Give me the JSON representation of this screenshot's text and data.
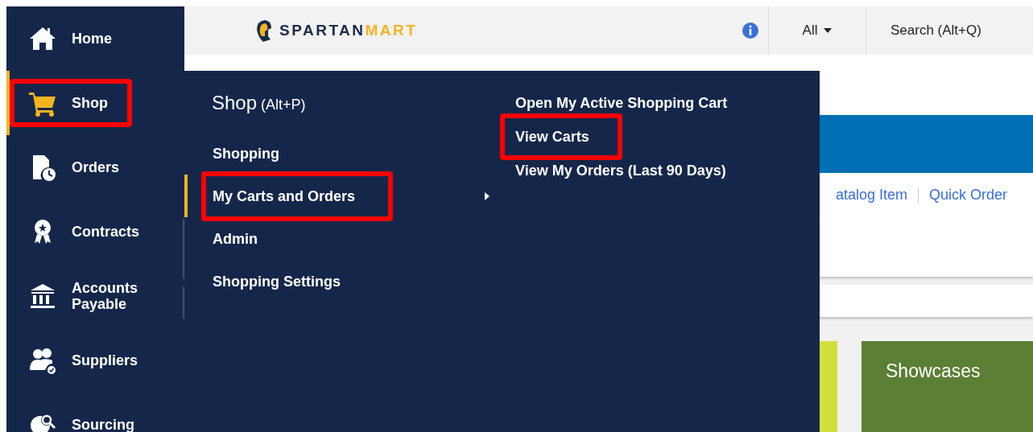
{
  "sidebar": {
    "items": [
      {
        "label": "Home",
        "selected": false
      },
      {
        "label": "Shop",
        "selected": true,
        "highlighted": true
      },
      {
        "label": "Orders",
        "selected": false
      },
      {
        "label": "Contracts",
        "selected": false
      },
      {
        "label": "Accounts Payable",
        "selected": false
      },
      {
        "label": "Suppliers",
        "selected": false
      },
      {
        "label": "Sourcing",
        "selected": false
      }
    ]
  },
  "header": {
    "logo": {
      "word_1": "SPARTAN",
      "word_2": "MART"
    },
    "scope": "All",
    "search": {
      "placeholder": "Search (Alt+Q)"
    }
  },
  "menu": {
    "title": "Shop",
    "shortcut": "(Alt+P)",
    "items": [
      {
        "label": "Shopping",
        "selected": false,
        "has_submenu": false,
        "highlighted": false
      },
      {
        "label": "My Carts and Orders",
        "selected": true,
        "has_submenu": true,
        "highlighted": true
      },
      {
        "label": "Admin",
        "selected": false,
        "has_submenu": false,
        "highlighted": false
      },
      {
        "label": "Shopping Settings",
        "selected": false,
        "has_submenu": false,
        "highlighted": false
      }
    ],
    "submenu": [
      {
        "label": "Open My Active Shopping Cart",
        "highlighted": false
      },
      {
        "label": "View Carts",
        "highlighted": true
      },
      {
        "label": "View My Orders (Last 90 Days)",
        "highlighted": false
      }
    ]
  },
  "content": {
    "links": [
      "atalog Item",
      "Quick Order"
    ],
    "tiles": [
      {
        "color": "#d4df3e"
      },
      {
        "color": "#5b7f34",
        "title": "Showcases"
      }
    ]
  }
}
